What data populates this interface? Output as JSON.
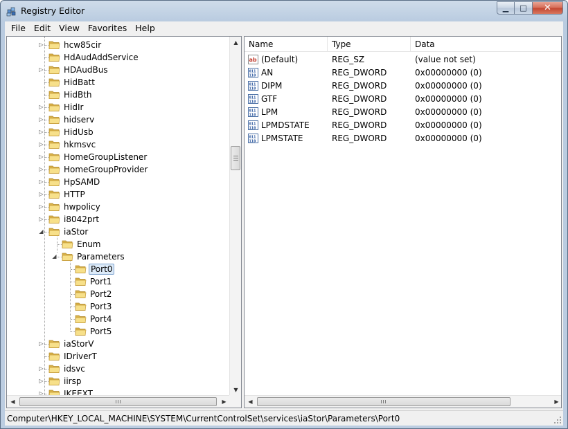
{
  "window": {
    "title": "Registry Editor",
    "caption_buttons": {
      "minimize": "▁",
      "maximize": "□",
      "close": "✕"
    }
  },
  "menu": [
    "File",
    "Edit",
    "View",
    "Favorites",
    "Help"
  ],
  "tree": {
    "rows": [
      {
        "label": "hcw85cir",
        "level": 0,
        "expander": "collapsed"
      },
      {
        "label": "HdAudAddService",
        "level": 0,
        "expander": "none"
      },
      {
        "label": "HDAudBus",
        "level": 0,
        "expander": "collapsed"
      },
      {
        "label": "HidBatt",
        "level": 0,
        "expander": "none"
      },
      {
        "label": "HidBth",
        "level": 0,
        "expander": "none"
      },
      {
        "label": "HidIr",
        "level": 0,
        "expander": "collapsed"
      },
      {
        "label": "hidserv",
        "level": 0,
        "expander": "collapsed"
      },
      {
        "label": "HidUsb",
        "level": 0,
        "expander": "collapsed"
      },
      {
        "label": "hkmsvc",
        "level": 0,
        "expander": "collapsed"
      },
      {
        "label": "HomeGroupListener",
        "level": 0,
        "expander": "collapsed"
      },
      {
        "label": "HomeGroupProvider",
        "level": 0,
        "expander": "collapsed"
      },
      {
        "label": "HpSAMD",
        "level": 0,
        "expander": "collapsed"
      },
      {
        "label": "HTTP",
        "level": 0,
        "expander": "collapsed"
      },
      {
        "label": "hwpolicy",
        "level": 0,
        "expander": "collapsed"
      },
      {
        "label": "i8042prt",
        "level": 0,
        "expander": "collapsed"
      },
      {
        "label": "iaStor",
        "level": 0,
        "expander": "expanded"
      },
      {
        "label": "Enum",
        "level": 1,
        "expander": "none"
      },
      {
        "label": "Parameters",
        "level": 1,
        "expander": "expanded"
      },
      {
        "label": "Port0",
        "level": 2,
        "expander": "none",
        "selected": true
      },
      {
        "label": "Port1",
        "level": 2,
        "expander": "none"
      },
      {
        "label": "Port2",
        "level": 2,
        "expander": "none"
      },
      {
        "label": "Port3",
        "level": 2,
        "expander": "none"
      },
      {
        "label": "Port4",
        "level": 2,
        "expander": "none"
      },
      {
        "label": "Port5",
        "level": 2,
        "expander": "none"
      },
      {
        "label": "iaStorV",
        "level": 0,
        "expander": "collapsed"
      },
      {
        "label": "IDriverT",
        "level": 0,
        "expander": "none"
      },
      {
        "label": "idsvc",
        "level": 0,
        "expander": "collapsed"
      },
      {
        "label": "iirsp",
        "level": 0,
        "expander": "collapsed"
      },
      {
        "label": "IKEEXT",
        "level": 0,
        "expander": "collapsed"
      }
    ]
  },
  "list": {
    "columns": [
      "Name",
      "Type",
      "Data"
    ],
    "rows": [
      {
        "icon": "string-value-icon",
        "name": "(Default)",
        "type": "REG_SZ",
        "data": "(value not set)"
      },
      {
        "icon": "binary-value-icon",
        "name": "AN",
        "type": "REG_DWORD",
        "data": "0x00000000 (0)"
      },
      {
        "icon": "binary-value-icon",
        "name": "DIPM",
        "type": "REG_DWORD",
        "data": "0x00000000 (0)"
      },
      {
        "icon": "binary-value-icon",
        "name": "GTF",
        "type": "REG_DWORD",
        "data": "0x00000000 (0)"
      },
      {
        "icon": "binary-value-icon",
        "name": "LPM",
        "type": "REG_DWORD",
        "data": "0x00000000 (0)"
      },
      {
        "icon": "binary-value-icon",
        "name": "LPMDSTATE",
        "type": "REG_DWORD",
        "data": "0x00000000 (0)"
      },
      {
        "icon": "binary-value-icon",
        "name": "LPMSTATE",
        "type": "REG_DWORD",
        "data": "0x00000000 (0)"
      }
    ]
  },
  "status": {
    "path": "Computer\\HKEY_LOCAL_MACHINE\\SYSTEM\\CurrentControlSet\\services\\iaStor\\Parameters\\Port0"
  },
  "colors": {
    "folder_light": "#f7e08a",
    "folder_dark": "#d9b24a",
    "selection_bg": "#dceaf8",
    "selection_border": "#7da2ce"
  }
}
